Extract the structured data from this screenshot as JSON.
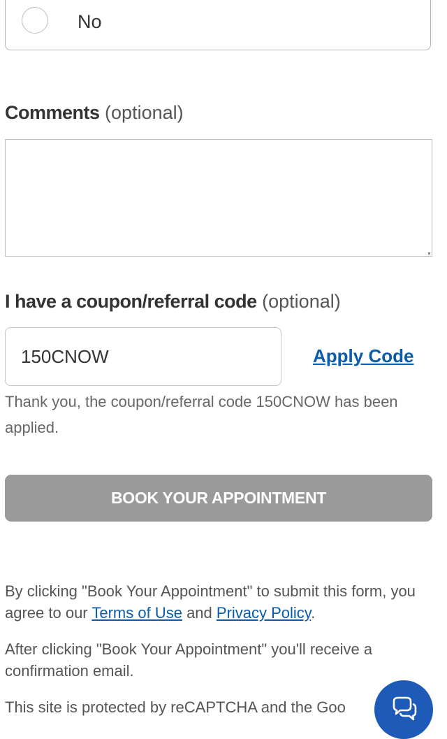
{
  "radio": {
    "label": "No"
  },
  "comments": {
    "label": "Comments",
    "optional": "(optional)",
    "value": ""
  },
  "coupon": {
    "label": "I have a coupon/referral code",
    "optional": "(optional)",
    "value": "150CNOW",
    "apply_label": "Apply Code",
    "message": "Thank you, the coupon/referral code 150CNOW has been applied."
  },
  "submit": {
    "label": "BOOK YOUR APPOINTMENT"
  },
  "legal": {
    "p1_before": "By clicking \"Book Your Appointment\" to submit this form, you agree to our ",
    "terms_link": "Terms of Use",
    "p1_and": " and ",
    "privacy_link": "Privacy Policy",
    "p1_end": ".",
    "p2": "After clicking \"Book Your Appointment\" you'll receive a confirmation email.",
    "p3": "This site is protected by reCAPTCHA and the Goo"
  },
  "chat": {
    "icon": "chat-bubbles-icon",
    "color": "#1e5bb8"
  },
  "colors": {
    "button_bg": "#9a9a9a",
    "link": "#0a5ca8"
  }
}
